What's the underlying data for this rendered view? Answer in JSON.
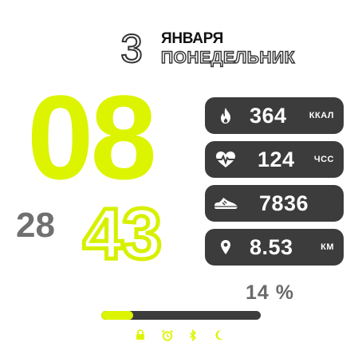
{
  "date": {
    "day": "3",
    "month": "ЯНВАРЯ",
    "weekday": "ПОНЕДЕЛЬНИК"
  },
  "time": {
    "hours": "08",
    "minutes": "43",
    "seconds": "28"
  },
  "stats": [
    {
      "icon": "flame-icon",
      "value": "364",
      "unit": "ККАЛ"
    },
    {
      "icon": "heart-rate-icon",
      "value": "124",
      "unit": "ЧСС"
    },
    {
      "icon": "shoe-icon",
      "value": "7836",
      "unit": ""
    },
    {
      "icon": "location-pin-icon",
      "value": "8.53",
      "unit": "КМ"
    }
  ],
  "battery": {
    "percent_label": "14 %",
    "level": 0.2
  },
  "status_icons": [
    "lock-icon",
    "alarm-icon",
    "bluetooth-icon",
    "moon-icon"
  ],
  "colors": {
    "accent": "#dcf400",
    "pill": "#3c3c3c",
    "muted": "#6a6a6a"
  }
}
